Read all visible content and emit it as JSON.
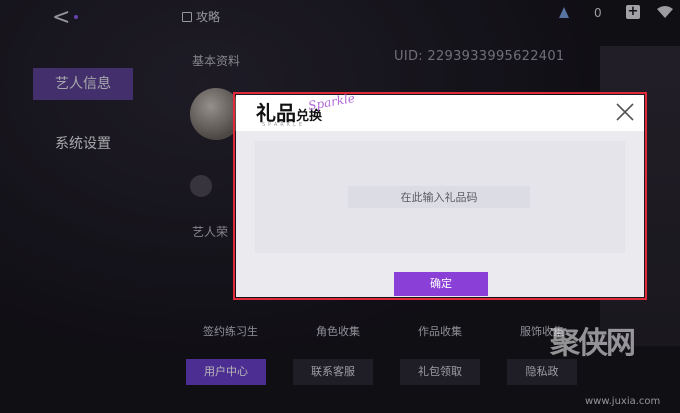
{
  "topbar": {
    "guide_label": "攻略",
    "currency_value": "0"
  },
  "sidebar": {
    "items": [
      {
        "label": "艺人信息",
        "active": true
      },
      {
        "label": "系统设置",
        "active": false
      }
    ]
  },
  "profile": {
    "basic_info_label": "基本资料",
    "uid": "UID: 2293933995622401",
    "artist_section_label": "艺人荣"
  },
  "collections": {
    "labels": [
      "签约练习生",
      "角色收集",
      "作品收集",
      "服饰收集"
    ]
  },
  "bottom_buttons": {
    "user_center": "用户中心",
    "contact_service": "联系客服",
    "gift_claim": "礼包领取",
    "privacy": "隐私政"
  },
  "modal": {
    "title_main": "礼品",
    "title_small": "兑换",
    "title_script": "Sparkle",
    "subtitle": "SPARKLE",
    "input_placeholder": "在此输入礼品码",
    "confirm_label": "确定",
    "outline_color": "#e02a3a",
    "confirm_color": "#8a3fd6"
  },
  "watermark": {
    "text": "聚侠网",
    "url": "www.juxia.com"
  }
}
